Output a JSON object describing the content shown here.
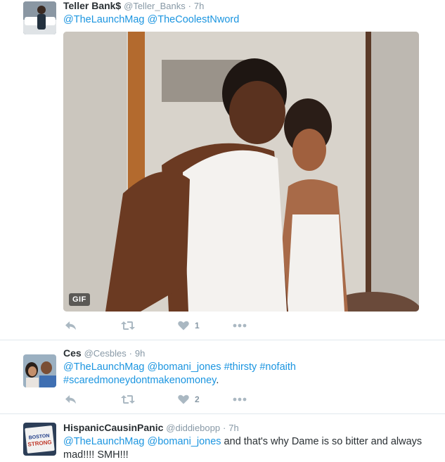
{
  "tweets": [
    {
      "name": "Teller Bank$",
      "handle": "@Teller_Banks",
      "sep": "·",
      "time": "7h",
      "text": [
        {
          "t": "@TheLaunchMag",
          "k": "mention"
        },
        {
          "t": " ",
          "k": "plain"
        },
        {
          "t": "@TheCoolestNword",
          "k": "mention"
        }
      ],
      "media_badge": "GIF",
      "likes": "1"
    },
    {
      "name": "Ces",
      "handle": "@Cesbles",
      "sep": "·",
      "time": "9h",
      "text": [
        {
          "t": "@TheLaunchMag",
          "k": "mention"
        },
        {
          "t": " ",
          "k": "plain"
        },
        {
          "t": "@bomani_jones",
          "k": "mention"
        },
        {
          "t": "  ",
          "k": "plain"
        },
        {
          "t": "#thirsty",
          "k": "hashtag"
        },
        {
          "t": " ",
          "k": "plain"
        },
        {
          "t": "#nofaith",
          "k": "hashtag"
        },
        {
          "t": " ",
          "k": "plain"
        },
        {
          "t": "#scaredmoneydontmakenomoney",
          "k": "hashtag"
        },
        {
          "t": ".",
          "k": "plain"
        }
      ],
      "likes": "2"
    },
    {
      "name": "HispanicCausinPanic",
      "handle": "@diddiebopp",
      "sep": "·",
      "time": "7h",
      "text": [
        {
          "t": "@TheLaunchMag",
          "k": "mention"
        },
        {
          "t": " ",
          "k": "plain"
        },
        {
          "t": "@bomani_jones",
          "k": "mention"
        },
        {
          "t": " and that's why Dame is so bitter and always mad!!!! SMH!!!",
          "k": "plain"
        }
      ],
      "avatar_sign_text": "BOSTON STRONG"
    }
  ],
  "icons": {
    "reply": "reply-icon",
    "retweet": "retweet-icon",
    "like": "heart-icon",
    "more": "more-icon"
  },
  "colors": {
    "link": "#1b95e0",
    "muted": "#8899a6",
    "icon": "#aab8c2",
    "divider": "#e1e8ed"
  }
}
